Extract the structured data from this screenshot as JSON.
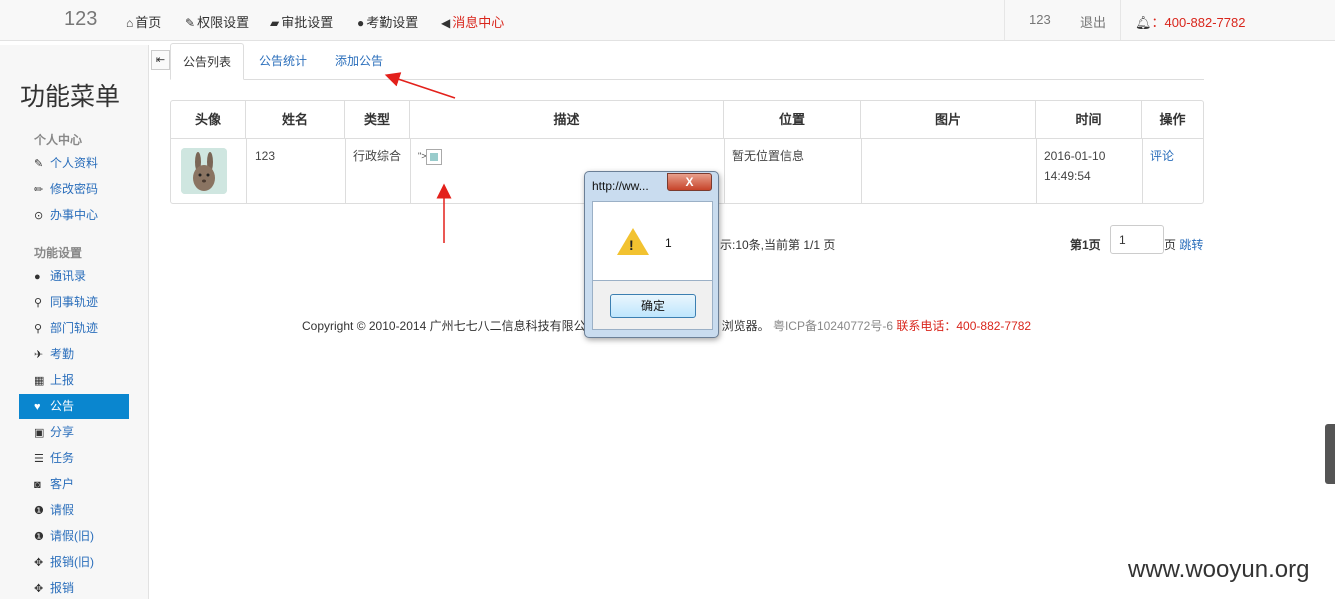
{
  "topbar": {
    "brand": "123",
    "nav": [
      {
        "icon": "home-icon",
        "label": "首页"
      },
      {
        "icon": "wrench-icon",
        "label": "权限设置"
      },
      {
        "icon": "folder-open-icon",
        "label": "审批设置"
      },
      {
        "icon": "globe-icon",
        "label": "考勤设置"
      },
      {
        "icon": "bullhorn-icon",
        "label": "消息中心"
      }
    ],
    "user": "123",
    "logout": "退出",
    "phone_label": "：400-882-7782"
  },
  "sidebar": {
    "title": "功能菜单",
    "groups": [
      {
        "heading": "个人中心",
        "items": [
          {
            "icon": "edit-icon",
            "label": "个人资料"
          },
          {
            "icon": "pencil-icon",
            "label": "修改密码"
          },
          {
            "icon": "check-circle-icon",
            "label": "办事中心"
          }
        ]
      },
      {
        "heading": "功能设置",
        "items": [
          {
            "icon": "user-icon",
            "label": "通讯录"
          },
          {
            "icon": "map-marker-icon",
            "label": "同事轨迹"
          },
          {
            "icon": "map-marker-icon",
            "label": "部门轨迹"
          },
          {
            "icon": "plane-icon",
            "label": "考勤"
          },
          {
            "icon": "calendar-icon",
            "label": "上报"
          },
          {
            "icon": "heart-icon",
            "label": "公告",
            "active": true
          },
          {
            "icon": "gift-icon",
            "label": "分享"
          },
          {
            "icon": "list-icon",
            "label": "任务"
          },
          {
            "icon": "camera-icon",
            "label": "客户"
          },
          {
            "icon": "info-icon",
            "label": "请假"
          },
          {
            "icon": "info-icon",
            "label": "请假(旧)"
          },
          {
            "icon": "move-icon",
            "label": "报销(旧)"
          },
          {
            "icon": "move-icon",
            "label": "报销"
          }
        ]
      }
    ]
  },
  "tabs": [
    {
      "label": "公告列表",
      "active": true
    },
    {
      "label": "公告统计"
    },
    {
      "label": "添加公告"
    }
  ],
  "table": {
    "headers": [
      "头像",
      "姓名",
      "类型",
      "描述",
      "位置",
      "图片",
      "时间",
      "操作"
    ],
    "rows": [
      {
        "name": "123",
        "type": "行政综合",
        "desc_prefix": "\">",
        "location": "暂无位置信息",
        "image": "",
        "date": "2016-01-10",
        "time": "14:49:54",
        "action": "评论"
      }
    ]
  },
  "pager": {
    "info": "示:10条,当前第 1/1 页",
    "current": "第1页",
    "input_value": "1",
    "suffix": "页",
    "jump": "跳转"
  },
  "footer": {
    "copyright": "Copyright © 2010-2014 广州七七八二信息科技有限公",
    "tail": "浏览器。",
    "icp": "粤ICP备10240772号-6",
    "contact": "联系电话：400-882-7782"
  },
  "dialog": {
    "title": "http://ww...",
    "close": "X",
    "message": "1",
    "ok": "确定"
  },
  "watermark": "www.wooyun.org",
  "colors": {
    "accent": "#0a86cf",
    "link": "#2a6ebb",
    "danger": "#d9261c"
  }
}
